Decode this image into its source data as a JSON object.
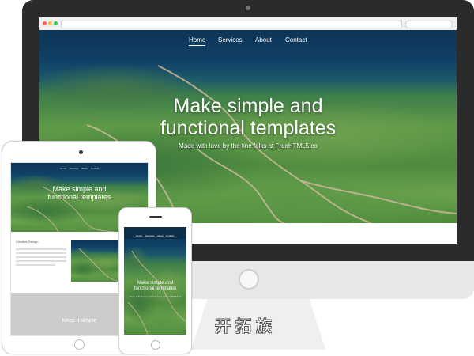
{
  "desktop": {
    "nav": [
      "Home",
      "Services",
      "About",
      "Contact"
    ],
    "active_nav": "Home",
    "hero_title_line1": "Make simple and",
    "hero_title_line2": "functional templates",
    "hero_subtitle": "Made with love by the fine folks at FreeHTML5.co"
  },
  "tablet": {
    "nav": [
      "Home",
      "Services",
      "Works",
      "Contact"
    ],
    "hero_title_line1": "Make simple and",
    "hero_title_line2": "functional templates",
    "section_title": "Creative Design",
    "footer_title": "Keep it simple"
  },
  "phone": {
    "nav": [
      "Home",
      "Services",
      "About",
      "Contact"
    ],
    "hero_title_line1": "Make simple and",
    "hero_title_line2": "functional templates",
    "hero_subtitle": "Made with love by the fine folks at FreeHTML5.co"
  },
  "watermark": "开拓族",
  "colors": {
    "bezel": "#2b2b2b",
    "sky": "#0d3557",
    "hills": "#5f9a48",
    "footer_gray": "#cccccc"
  },
  "icons": [
    "close-dot",
    "minimize-dot",
    "maximize-dot",
    "back-arrow-icon",
    "forward-arrow-icon"
  ]
}
